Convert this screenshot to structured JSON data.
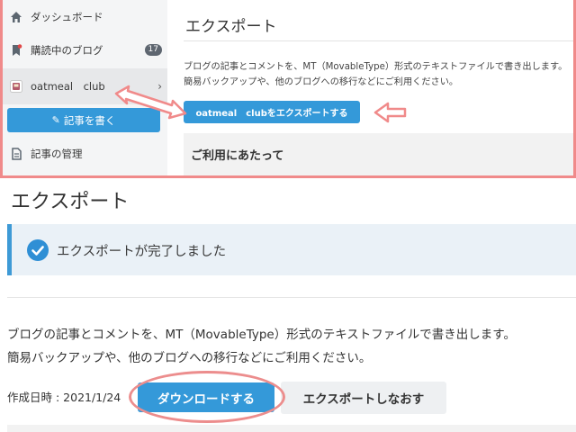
{
  "sidebar": {
    "dashboard_label": "ダッシュボード",
    "subscribed_label": "購読中のブログ",
    "subscribed_count": "17",
    "blog_name": "oatmeal　club",
    "write_label": "記事を書く",
    "manage_label": "記事の管理"
  },
  "top": {
    "title": "エクスポート",
    "desc_line1": "ブログの記事とコメントを、MT（MovableType）形式のテキストファイルで書き出します。",
    "desc_line2": "簡易バックアップや、他のブログへの移行などにご利用ください。",
    "export_button": "oatmeal　clubをエクスポートする",
    "notice_title": "ご利用にあたって"
  },
  "bottom": {
    "page_title": "エクスポート",
    "success_message": "エクスポートが完了しました",
    "desc_line1": "ブログの記事とコメントを、MT（MovableType）形式のテキストファイルで書き出します。",
    "desc_line2": "簡易バックアップや、他のブログへの移行などにご利用ください。",
    "created_label": "作成日時 : 2021/1/24",
    "download_button": "ダウンロードする",
    "reexport_button": "エクスポートしなおす"
  },
  "colors": {
    "accent_blue": "#3499d9",
    "annotation_pink": "#f08a8a",
    "success_border": "#3e9ad6"
  },
  "icons": {
    "dashboard": "home-icon",
    "subscribed": "bookmark-icon",
    "blog": "blog-avatar-icon",
    "write": "pencil-square-icon",
    "manage": "document-icon",
    "success": "check-circle-icon",
    "expand": "chevron-right-icon"
  }
}
